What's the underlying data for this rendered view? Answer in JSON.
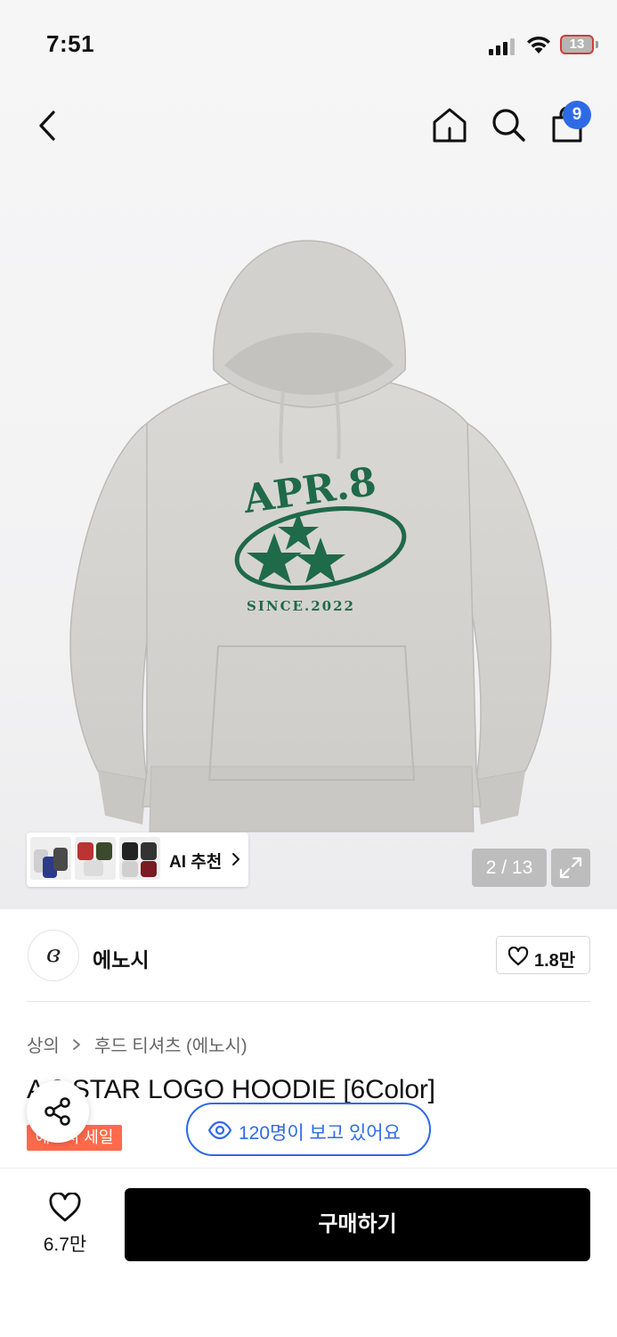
{
  "status_bar": {
    "time": "7:51",
    "battery": "13"
  },
  "nav": {
    "cart_count": "9"
  },
  "product_image": {
    "print_top": "APR.8",
    "print_bottom": "SINCE.2022",
    "counter": "2 / 13"
  },
  "ai_recommend": {
    "label": "AI 추천"
  },
  "brand": {
    "logo_mark": "ɞ",
    "name": "에노시",
    "likes": "1.8만"
  },
  "breadcrumb": {
    "category": "상의",
    "subcategory": "후드 티셔츠 (에노시)"
  },
  "product": {
    "title_visible": "A   8 STAR LOGO HOODIE [6Color]",
    "sale_badge": "에노시 세일"
  },
  "viewers": {
    "text": "120명이 보고 있어요"
  },
  "bottom_bar": {
    "wish_count": "6.7만",
    "buy_label": "구매하기"
  },
  "colors": {
    "accent_blue": "#2f6ae6",
    "sale_orange": "#ff6a4a",
    "print_green": "#1f6a48",
    "hoodie_gray": "#d9d7d3"
  },
  "icons": [
    "back-icon",
    "home-icon",
    "search-icon",
    "cart-icon",
    "expand-icon",
    "heart-icon",
    "share-icon",
    "eye-icon",
    "chevron-right-icon"
  ]
}
